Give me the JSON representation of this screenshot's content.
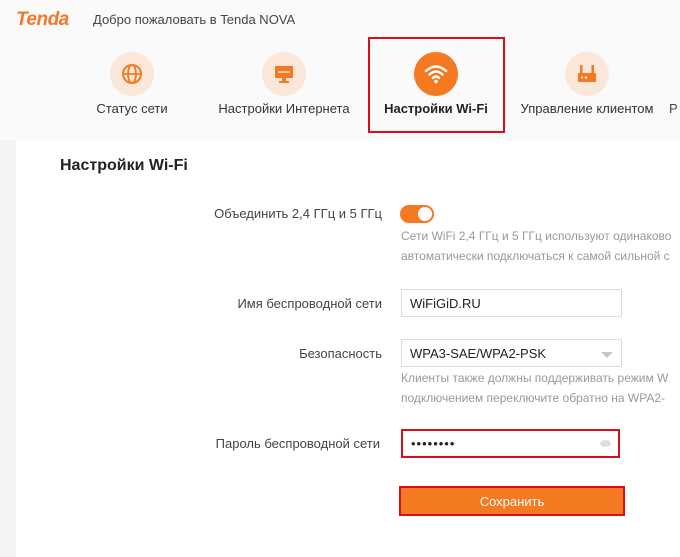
{
  "header": {
    "logo": "Tenda",
    "welcome": "Добро пожаловать в Tenda NOVA"
  },
  "nav": {
    "items": [
      {
        "label": "Статус сети",
        "icon": "globe-icon"
      },
      {
        "label": "Настройки Интернета",
        "icon": "monitor-icon"
      },
      {
        "label": "Настройки Wi-Fi",
        "icon": "wifi-icon",
        "active": true
      },
      {
        "label": "Управление клиентом",
        "icon": "router-icon"
      },
      {
        "label": "Р"
      }
    ]
  },
  "page": {
    "title": "Настройки Wi-Fi",
    "merge_band": {
      "label": "Объединить 2,4 ГГц и 5 ГГц",
      "enabled": true,
      "hint_line1": "Сети WiFi 2,4 ГГц и 5 ГГц используют одинаково",
      "hint_line2": "автоматически подключаться к самой сильной с"
    },
    "ssid": {
      "label": "Имя беспроводной сети",
      "value": "WiFiGiD.RU"
    },
    "security": {
      "label": "Безопасность",
      "value": "WPA3-SAE/WPA2-PSK",
      "hint_line1": "Клиенты также должны поддерживать режим W",
      "hint_line2": "подключением переключите обратно на WPA2-"
    },
    "password": {
      "label": "Пароль беспроводной сети",
      "value": "••••••••"
    },
    "save_label": "Сохранить"
  },
  "colors": {
    "accent": "#f47920",
    "highlight": "#d90e1a",
    "icon_bg": "#fbe7d9"
  }
}
